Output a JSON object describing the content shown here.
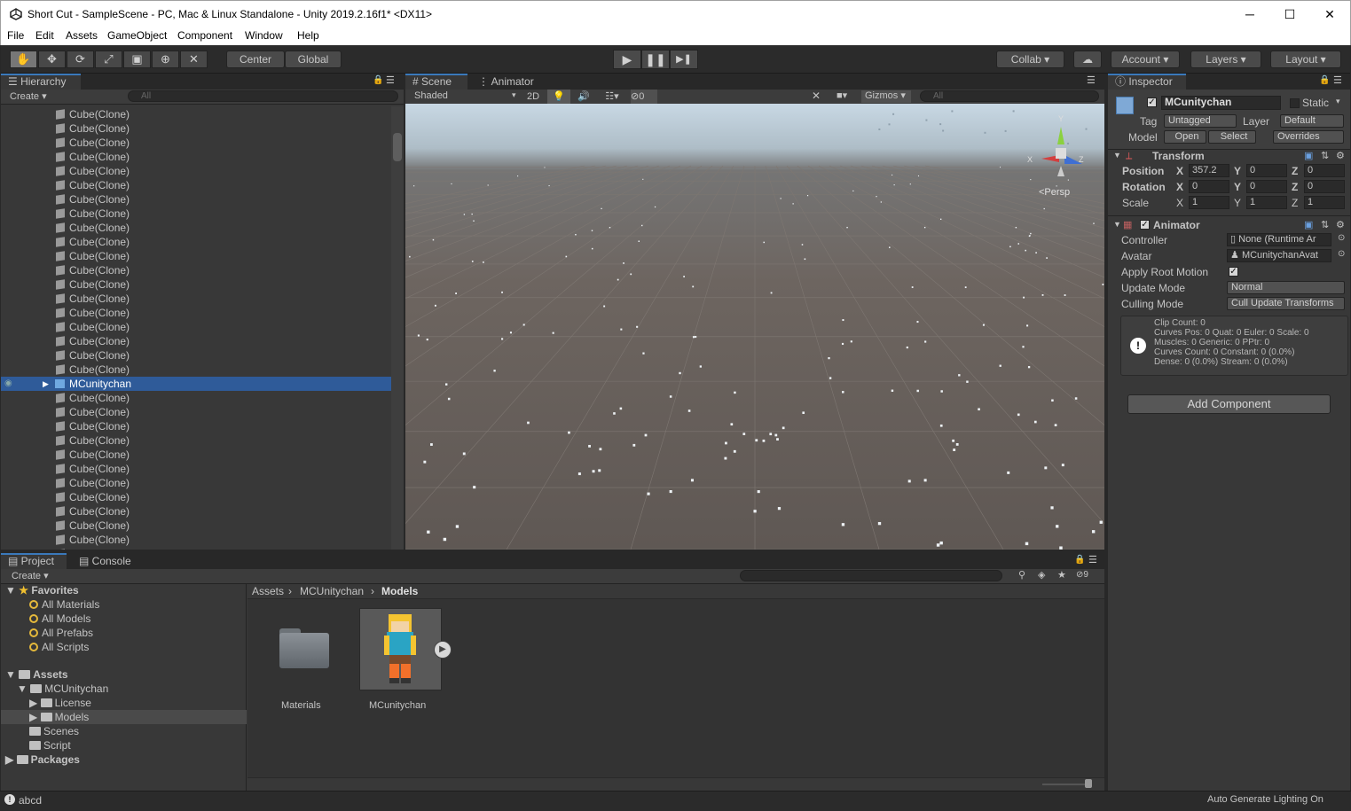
{
  "window": {
    "title": "Short Cut - SampleScene - PC, Mac & Linux Standalone - Unity 2019.2.16f1* <DX11>",
    "minimize": "─",
    "maximize": "☐",
    "close": "✕"
  },
  "menu": [
    "File",
    "Edit",
    "Assets",
    "GameObject",
    "Component",
    "Window",
    "Help"
  ],
  "toolbar": {
    "tools": [
      "✋",
      "✥",
      "⟳",
      "⤢",
      "▣",
      "⊕",
      "✕"
    ],
    "center": "Center",
    "global": "Global",
    "play": "▶",
    "pause": "❚❚",
    "step": "▶❚",
    "collab": "Collab",
    "account": "Account",
    "layers": "Layers",
    "layout": "Layout"
  },
  "hierarchy": {
    "tab": "Hierarchy",
    "create": "Create",
    "search_placeholder": "All",
    "rows_before": [
      "Cube(Clone)",
      "Cube(Clone)",
      "Cube(Clone)",
      "Cube(Clone)",
      "Cube(Clone)",
      "Cube(Clone)",
      "Cube(Clone)",
      "Cube(Clone)",
      "Cube(Clone)",
      "Cube(Clone)",
      "Cube(Clone)",
      "Cube(Clone)",
      "Cube(Clone)",
      "Cube(Clone)",
      "Cube(Clone)",
      "Cube(Clone)",
      "Cube(Clone)",
      "Cube(Clone)",
      "Cube(Clone)"
    ],
    "selected": "MCunitychan",
    "rows_after": [
      "Cube(Clone)",
      "Cube(Clone)",
      "Cube(Clone)",
      "Cube(Clone)",
      "Cube(Clone)",
      "Cube(Clone)",
      "Cube(Clone)",
      "Cube(Clone)",
      "Cube(Clone)",
      "Cube(Clone)",
      "Cube(Clone)",
      "Cube(Clone)"
    ]
  },
  "scene": {
    "tab_scene": "Scene",
    "tab_animator": "Animator",
    "shading": "Shaded",
    "mode2d": "2D",
    "hidden_count": "0",
    "gizmos": "Gizmos",
    "search_placeholder": "All",
    "persp": "<Persp",
    "axis_x": "X",
    "axis_y": "Y",
    "axis_z": "Z"
  },
  "inspector": {
    "tab": "Inspector",
    "object_name": "MCunitychan",
    "static_label": "Static",
    "tag_label": "Tag",
    "tag_value": "Untagged",
    "layer_label": "Layer",
    "layer_value": "Default",
    "model_label": "Model",
    "open": "Open",
    "select": "Select",
    "overrides": "Overrides",
    "transform": {
      "title": "Transform",
      "position_label": "Position",
      "rotation_label": "Rotation",
      "scale_label": "Scale",
      "x": "X",
      "y": "Y",
      "z": "Z",
      "position": [
        "357.2",
        "0",
        "0"
      ],
      "rotation": [
        "0",
        "0",
        "0"
      ],
      "scale": [
        "1",
        "1",
        "1"
      ]
    },
    "animator": {
      "title": "Animator",
      "controller_label": "Controller",
      "controller_value": "None (Runtime Ar",
      "avatar_label": "Avatar",
      "avatar_value": "MCunitychanAvat",
      "apply_root_motion_label": "Apply Root Motion",
      "update_mode_label": "Update Mode",
      "update_mode_value": "Normal",
      "culling_mode_label": "Culling Mode",
      "culling_mode_value": "Cull Update Transforms",
      "info": [
        "Clip Count: 0",
        "Curves Pos: 0 Quat: 0 Euler: 0 Scale: 0",
        "Muscles: 0 Generic: 0 PPtr: 0",
        "Curves Count: 0 Constant: 0 (0.0%)",
        "Dense: 0 (0.0%) Stream: 0 (0.0%)"
      ]
    },
    "add_component": "Add Component"
  },
  "project": {
    "tab_project": "Project",
    "tab_console": "Console",
    "create": "Create",
    "hidden_count": "9",
    "favorites": "Favorites",
    "fav_items": [
      "All Materials",
      "All Models",
      "All Prefabs",
      "All Scripts"
    ],
    "assets": "Assets",
    "mcunitychan": "MCUnitychan",
    "license": "License",
    "models": "Models",
    "scenes": "Scenes",
    "script": "Script",
    "packages": "Packages",
    "breadcrumb": [
      "Assets",
      "MCUnitychan",
      "Models"
    ],
    "grid": [
      "Materials",
      "MCunitychan"
    ]
  },
  "status": {
    "left": "abcd",
    "right": "Auto Generate Lighting On"
  }
}
